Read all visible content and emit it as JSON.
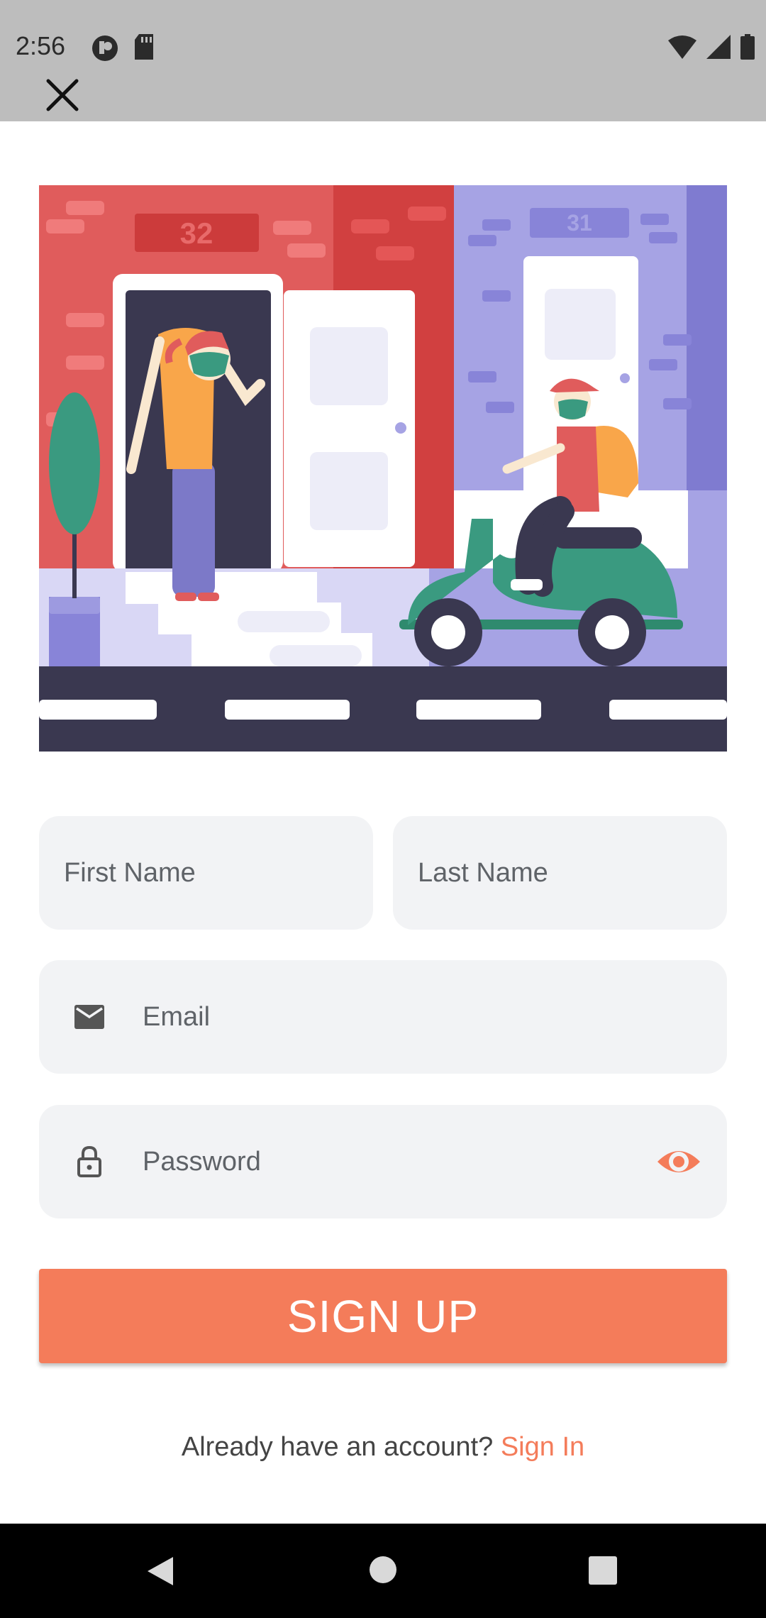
{
  "status_bar": {
    "time": "2:56",
    "left_icons": [
      "app-notification-icon",
      "sd-card-icon"
    ],
    "right_icons": [
      "wifi-icon",
      "signal-icon",
      "battery-icon"
    ]
  },
  "header": {
    "close_icon": "close-icon"
  },
  "illustration": {
    "left_house_number": "32",
    "right_house_number": "31"
  },
  "form": {
    "first_name_placeholder": "First Name",
    "last_name_placeholder": "Last Name",
    "email_placeholder": "Email",
    "password_placeholder": "Password",
    "email_icon": "mail-icon",
    "password_icon": "lock-icon",
    "visibility_icon": "eye-icon"
  },
  "actions": {
    "signup_label": "SIGN UP",
    "signin_prompt": "Already have an account?",
    "signin_link": "Sign In"
  },
  "colors": {
    "accent": "#f47c5a",
    "field_bg": "#f2f3f5",
    "status_bar_bg": "#bdbdbd",
    "nav_bar_bg": "#000000"
  }
}
